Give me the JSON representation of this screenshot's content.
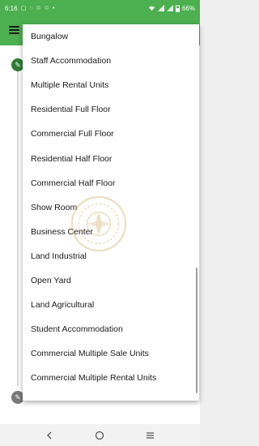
{
  "status": {
    "time": "6:16",
    "battery": "66%",
    "left_icons": [
      "notification-icon",
      "sync-icon",
      "recycle-icon",
      "recycle-icon",
      "dot-icon"
    ],
    "right_icons": [
      "wifi-icon",
      "signal-icon",
      "signal-icon",
      "battery-icon"
    ]
  },
  "colors": {
    "primary": "#4caf50",
    "primary_dark": "#2e7d32",
    "surface": "#ffffff"
  },
  "dropdown": {
    "items": [
      "Bungalow",
      "Staff Accommodation",
      "Multiple Rental Units",
      "Residential Full Floor",
      "Commercial Full Floor",
      "Residential Half Floor",
      "Commercial Half Floor",
      "Show Room",
      "Business Center",
      "Land Industrial",
      "Open Yard",
      "Land Agricultural",
      "Student Accommodation",
      "Commercial Multiple Sale Units",
      "Commercial Multiple Rental Units"
    ]
  }
}
